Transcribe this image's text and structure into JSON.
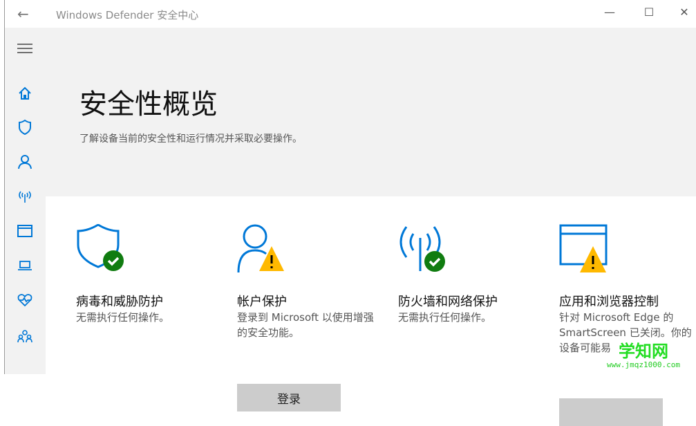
{
  "window": {
    "title": "Windows Defender 安全中心",
    "back": "←",
    "minimize": "—",
    "maximize": "☐",
    "close": "✕"
  },
  "sidebar": {
    "items": [
      "menu-icon",
      "home-icon",
      "shield-icon",
      "account-icon",
      "network-icon",
      "browser-icon",
      "laptop-icon",
      "health-icon",
      "family-icon"
    ]
  },
  "main": {
    "title": "安全性概览",
    "subtitle": "了解设备当前的安全性和运行情况并采取必要操作。"
  },
  "cards": [
    {
      "title": "病毒和威胁防护",
      "desc": "无需执行任何操作。",
      "status": "ok"
    },
    {
      "title": "帐户保护",
      "desc": "登录到 Microsoft 以使用增强的安全功能。",
      "status": "warning",
      "button": "登录"
    },
    {
      "title": "防火墙和网络保护",
      "desc": "无需执行任何操作。",
      "status": "ok"
    },
    {
      "title": "应用和浏览器控制",
      "desc": "针对 Microsoft Edge 的 SmartScreen 已关闭。你的设备可能易",
      "status": "warning"
    }
  ],
  "watermark": {
    "name": "学知网",
    "url": "www.jmqz1000.com"
  },
  "colors": {
    "accent": "#0078d7",
    "ok": "#107c10",
    "warning": "#ffb900"
  }
}
